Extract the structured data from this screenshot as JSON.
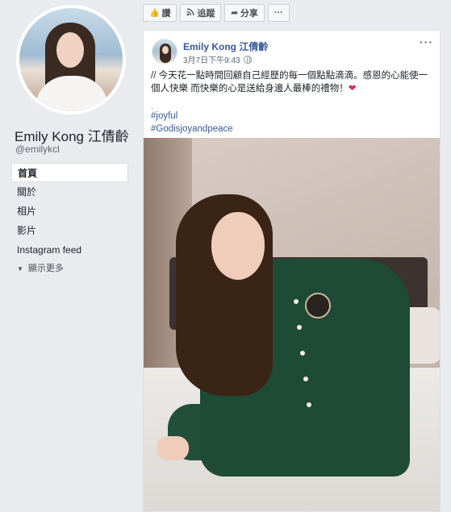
{
  "profile": {
    "name": "Emily Kong 江倩齡",
    "handle": "@emilykcl"
  },
  "nav": {
    "items": [
      {
        "label": "首頁",
        "active": true
      },
      {
        "label": "關於",
        "active": false
      },
      {
        "label": "相片",
        "active": false
      },
      {
        "label": "影片",
        "active": false
      },
      {
        "label": "Instagram feed",
        "active": false
      }
    ],
    "more_label": "顯示更多"
  },
  "actionbar": {
    "like_label": "讚",
    "follow_label": "追蹤",
    "share_label": "分享",
    "more_label": "···"
  },
  "post": {
    "author": "Emily Kong 江倩齡",
    "time": "3月7日下午9:43",
    "more_label": "···",
    "text": "// 今天花一點時間回顧自己經歷的每一個點點滴滴。感恩的心能使一個人快樂 而快樂的心是送給身邊人最棒的禮物！",
    "heart": "❤",
    "dot": ".",
    "hashtags": [
      "#joyful",
      "#Godisjoyandpeace"
    ]
  },
  "icons": {
    "like": "thumbs-up-icon",
    "follow": "rss-icon",
    "share": "share-arrow-icon",
    "privacy": "globe-icon"
  }
}
